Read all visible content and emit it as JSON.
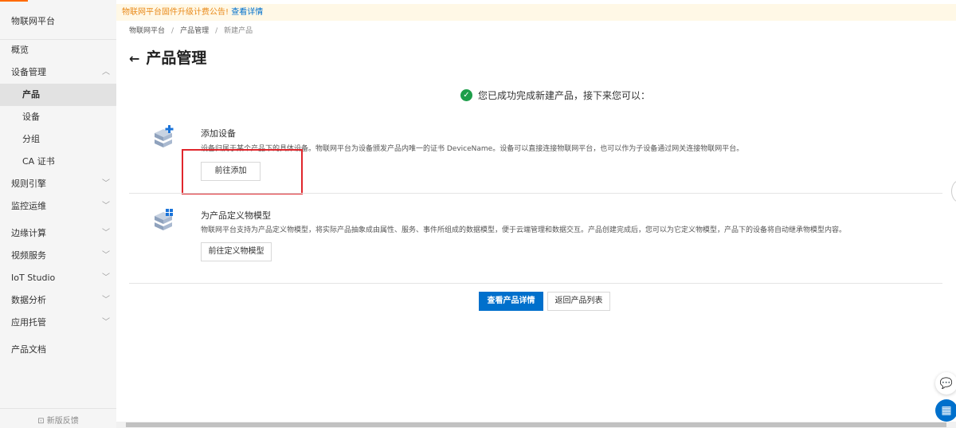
{
  "sidebar": {
    "title": "物联网平台",
    "items": [
      {
        "label": "概览"
      },
      {
        "label": "设备管理"
      },
      {
        "label": "产品"
      },
      {
        "label": "设备"
      },
      {
        "label": "分组"
      },
      {
        "label": "CA 证书"
      },
      {
        "label": "规则引擎"
      },
      {
        "label": "监控运维"
      },
      {
        "label": "边缘计算"
      },
      {
        "label": "视频服务"
      },
      {
        "label": "IoT Studio"
      },
      {
        "label": "数据分析"
      },
      {
        "label": "应用托管"
      },
      {
        "label": "产品文档"
      }
    ],
    "feedback": "新版反馈"
  },
  "notice": {
    "text": "物联网平台固件升级计费公告!",
    "link": "查看详情"
  },
  "breadcrumb": [
    "物联网平台",
    "产品管理",
    "新建产品"
  ],
  "page_title": "产品管理",
  "success_message": "您已成功完成新建产品，接下来您可以：",
  "sections": [
    {
      "title": "添加设备",
      "desc": "设备归属于某个产品下的具体设备。物联网平台为设备颁发产品内唯一的证书 DeviceName。设备可以直接连接物联网平台，也可以作为子设备通过网关连接物联网平台。",
      "button": "前往添加"
    },
    {
      "title": "为产品定义物模型",
      "desc": "物联网平台支持为产品定义物模型，将实际产品抽象成由属性、服务、事件所组成的数据模型，便于云端管理和数据交互。产品创建完成后，您可以为它定义物模型，产品下的设备将自动继承物模型内容。",
      "button": "前往定义物模型"
    }
  ],
  "actions": {
    "view_detail": "查看产品详情",
    "back_list": "返回产品列表"
  },
  "colors": {
    "primary": "#0070cc",
    "success": "#1e9e4a",
    "highlight": "#e0262c"
  }
}
